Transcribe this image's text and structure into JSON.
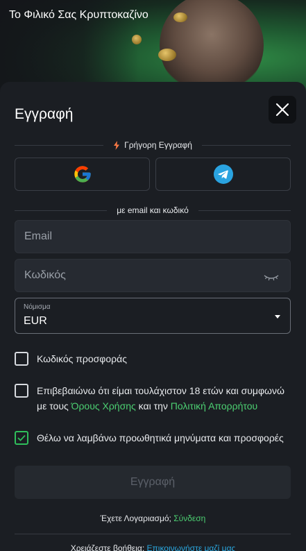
{
  "hero": {
    "title": "Το Φιλικό Σας Κρυπτοκαζίνο"
  },
  "modal": {
    "title": "Εγγραφή",
    "quick_label": "Γρήγορη Εγγραφή",
    "email_divider": "με email και κωδικό",
    "email_placeholder": "Email",
    "password_placeholder": "Κωδικός",
    "currency": {
      "label": "Νόμισμα",
      "value": "EUR"
    },
    "promo_label": "Κωδικός προσφοράς",
    "age_text_1": "Επιβεβαιώνω ότι είμαι τουλάχιστον 18 ετών και συμφωνώ με τους ",
    "terms_link": "Όρους Χρήσης",
    "age_text_2": " και την ",
    "privacy_link": "Πολιτική Απορρήτου",
    "marketing_label": "Θέλω να λαμβάνω προωθητικά μηνύματα και προσφορές",
    "marketing_checked": true,
    "submit_label": "Εγγραφή",
    "has_account": "Έχετε Λογαριασμό; ",
    "login_link": "Σύνδεση",
    "help_text": "Χρειάζεστε βοήθεια; ",
    "contact_link": "Επικοινωνήστε μαζί μας"
  },
  "colors": {
    "accent_green": "#4cd072",
    "link_blue": "#2aa8e0",
    "background": "#1b1e23"
  },
  "icons": [
    "close-icon",
    "lightning-icon",
    "google-icon",
    "telegram-icon",
    "eye-closed-icon",
    "caret-down-icon",
    "checkmark-icon"
  ]
}
